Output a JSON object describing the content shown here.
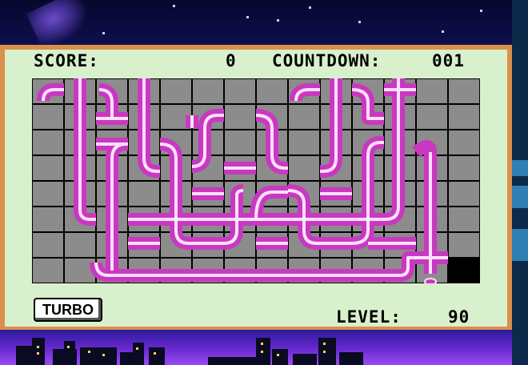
{
  "hud": {
    "score_label": "SCORE:",
    "score_value": "0",
    "countdown_label": "COUNTDOWN:",
    "countdown_value": "001",
    "level_label": "LEVEL:",
    "level_value": "90"
  },
  "buttons": {
    "turbo_label": "TURBO"
  },
  "colors": {
    "panel": "#d8f0cc",
    "frame": "#d8904a",
    "grid_cell": "#8c8c8c",
    "pipe_main": "#c838c0",
    "pipe_highlight": "#ffe0ff",
    "sky": "#07072e"
  },
  "board": {
    "columns": 14,
    "rows": 8
  },
  "icons": [
    "nebula-icon",
    "star-icon",
    "city-skyline-icon"
  ]
}
